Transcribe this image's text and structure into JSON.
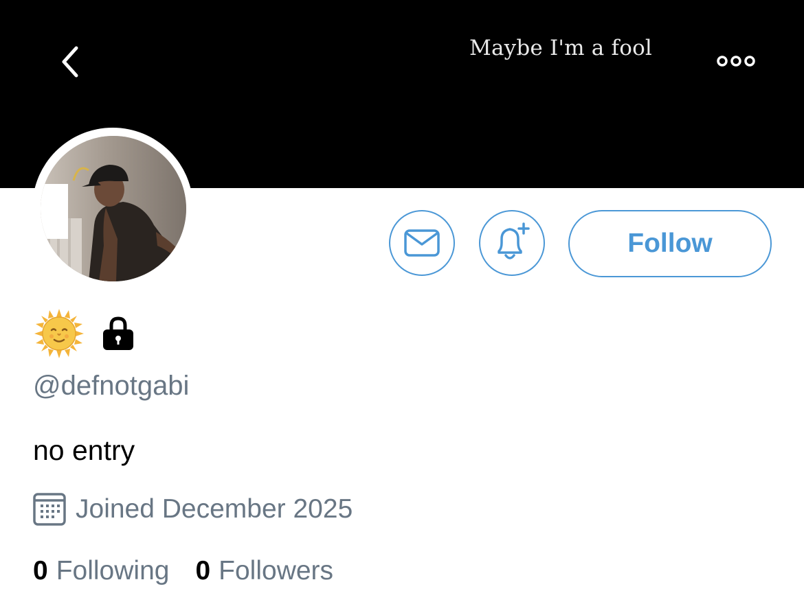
{
  "header": {
    "title": "Maybe I'm a fool",
    "back_icon": "chevron-left-icon",
    "more_icon": "more-dots-icon"
  },
  "profile": {
    "avatar_alt": "profile photo",
    "display_name_emoji": "sun-with-face",
    "protected_icon": "lock-icon",
    "handle": "@defnotgabi",
    "bio": "no entry",
    "joined": "Joined December 2025"
  },
  "actions": {
    "message_icon": "envelope-icon",
    "notify_icon": "bell-plus-icon",
    "follow_label": "Follow"
  },
  "stats": {
    "following_count": "0",
    "following_label": "Following",
    "followers_count": "0",
    "followers_label": "Followers"
  },
  "colors": {
    "accent": "#4a97d6",
    "secondary_text": "#687684",
    "banner": "#000000"
  }
}
